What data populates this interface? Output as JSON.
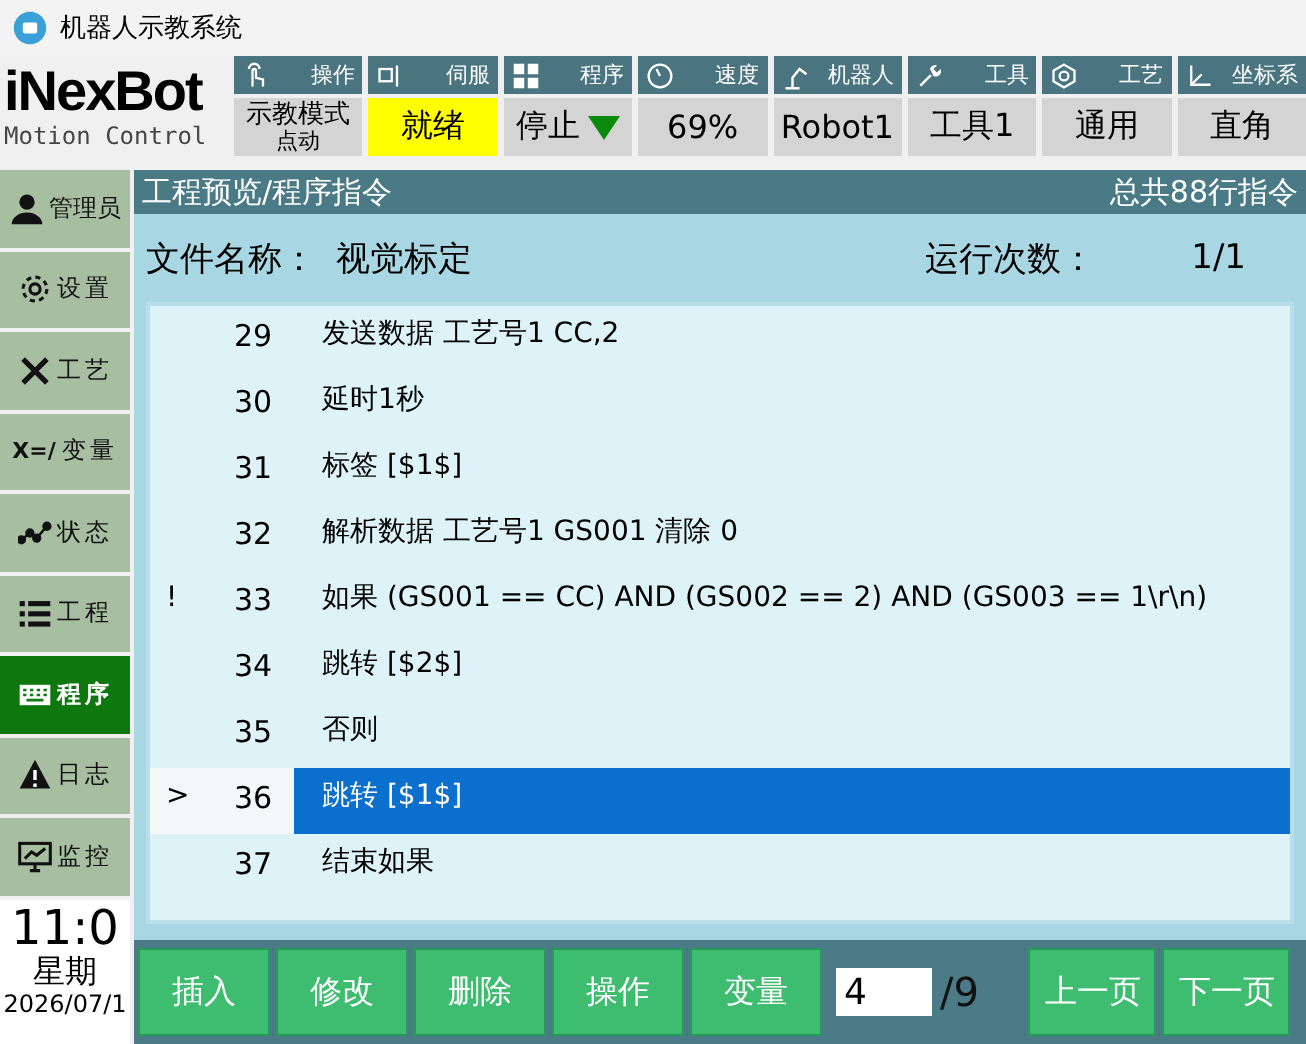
{
  "window": {
    "title": "机器人示教系统"
  },
  "logo": {
    "brand": "iNexBot",
    "tagline": "Motion Control"
  },
  "status": [
    {
      "label": "操作",
      "value": "示教模式",
      "sub": "点动",
      "highlight": false,
      "dropdown": false
    },
    {
      "label": "伺服",
      "value": "就绪",
      "highlight": true,
      "dropdown": false
    },
    {
      "label": "程序",
      "value": "停止",
      "highlight": false,
      "dropdown": true
    },
    {
      "label": "速度",
      "value": "69%",
      "highlight": false,
      "dropdown": false
    },
    {
      "label": "机器人",
      "value": "Robot1",
      "highlight": false,
      "dropdown": false
    },
    {
      "label": "工具",
      "value": "工具1",
      "highlight": false,
      "dropdown": false
    },
    {
      "label": "工艺",
      "value": "通用",
      "highlight": false,
      "dropdown": false
    },
    {
      "label": "坐标系",
      "value": "直角",
      "highlight": false,
      "dropdown": false
    }
  ],
  "sidebar": {
    "items": [
      {
        "label": "管理员",
        "selected": false
      },
      {
        "label": "设置",
        "selected": false
      },
      {
        "label": "工艺",
        "selected": false
      },
      {
        "prefix": "X=/",
        "label": "变量",
        "selected": false
      },
      {
        "label": "状态",
        "selected": false
      },
      {
        "label": "工程",
        "selected": false
      },
      {
        "label": "程序",
        "selected": true
      },
      {
        "label": "日志",
        "selected": false
      },
      {
        "label": "监控",
        "selected": false
      }
    ],
    "clock": {
      "time": "11:0",
      "day": "星期",
      "date": "2026/07/1"
    }
  },
  "panel": {
    "title": "工程预览/程序指令",
    "total": "总共88行指令",
    "file_label": "文件名称：",
    "file_name": "视觉标定",
    "runs_label": "运行次数：",
    "runs": "1/1"
  },
  "program": {
    "rows": [
      {
        "line": "29",
        "text": "发送数据 工艺号1 CC,2",
        "selected": false
      },
      {
        "line": "30",
        "text": "延时1秒",
        "selected": false
      },
      {
        "line": "31",
        "text": "标签 [$1$]",
        "selected": false
      },
      {
        "line": "32",
        "text": "解析数据 工艺号1 GS001 清除 0",
        "selected": false
      },
      {
        "mark": "!",
        "line": "33",
        "text": "如果 (GS001 == CC) AND (GS002 == 2) AND (GS003 == 1\\r\\n)",
        "selected": false
      },
      {
        "line": "34",
        "text": "跳转 [$2$]",
        "selected": false
      },
      {
        "line": "35",
        "text": "否则",
        "selected": false
      },
      {
        "mark": ">",
        "line": "36",
        "text": "跳转 [$1$]",
        "selected": true
      },
      {
        "line": "37",
        "text": "结束如果",
        "selected": false
      }
    ]
  },
  "toolbar": {
    "buttons": [
      "插入",
      "修改",
      "删除",
      "操作",
      "变量"
    ],
    "page": "4",
    "pages": "/9",
    "nav": [
      "上一页",
      "下一页"
    ]
  }
}
